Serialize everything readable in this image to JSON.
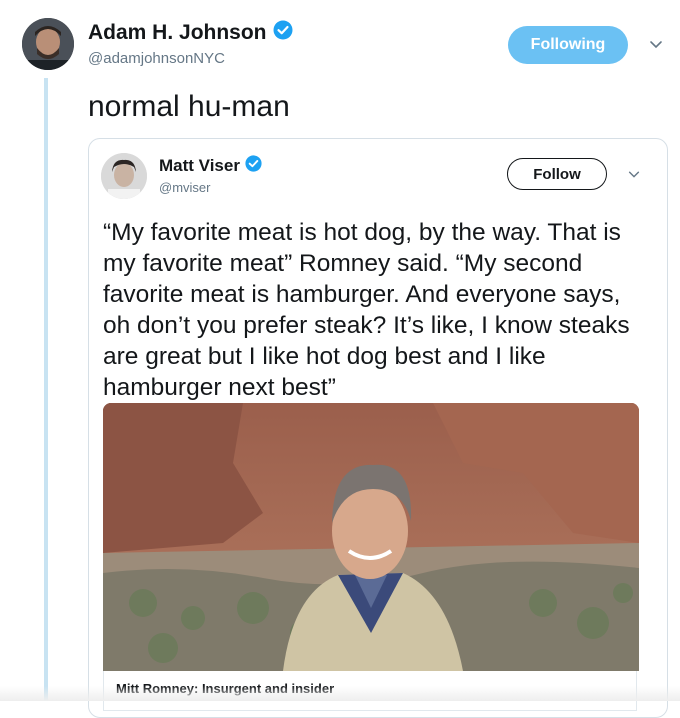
{
  "tweet": {
    "author_name": "Adam H. Johnson",
    "author_handle": "@adamjohnsonNYC",
    "follow_label": "Following",
    "text": "normal hu-man"
  },
  "quoted": {
    "author_name": "Matt Viser",
    "author_handle": "@mviser",
    "follow_label": "Follow",
    "text": "“My favorite meat is hot dog, by the way. That is my favorite meat” Romney said. “My second favorite meat is hamburger. And everyone says, oh don’t you prefer steak? It’s like, I know steaks are great but I like hot dog best and I like hamburger next best”",
    "card_caption": "Mitt Romney: Insurgent and insider"
  },
  "colors": {
    "accent": "#1da1f2",
    "following_bg": "#6bc1f3",
    "thread_line": "#c8e3f2"
  },
  "icons": [
    "verified-badge-icon",
    "chevron-down-icon"
  ]
}
